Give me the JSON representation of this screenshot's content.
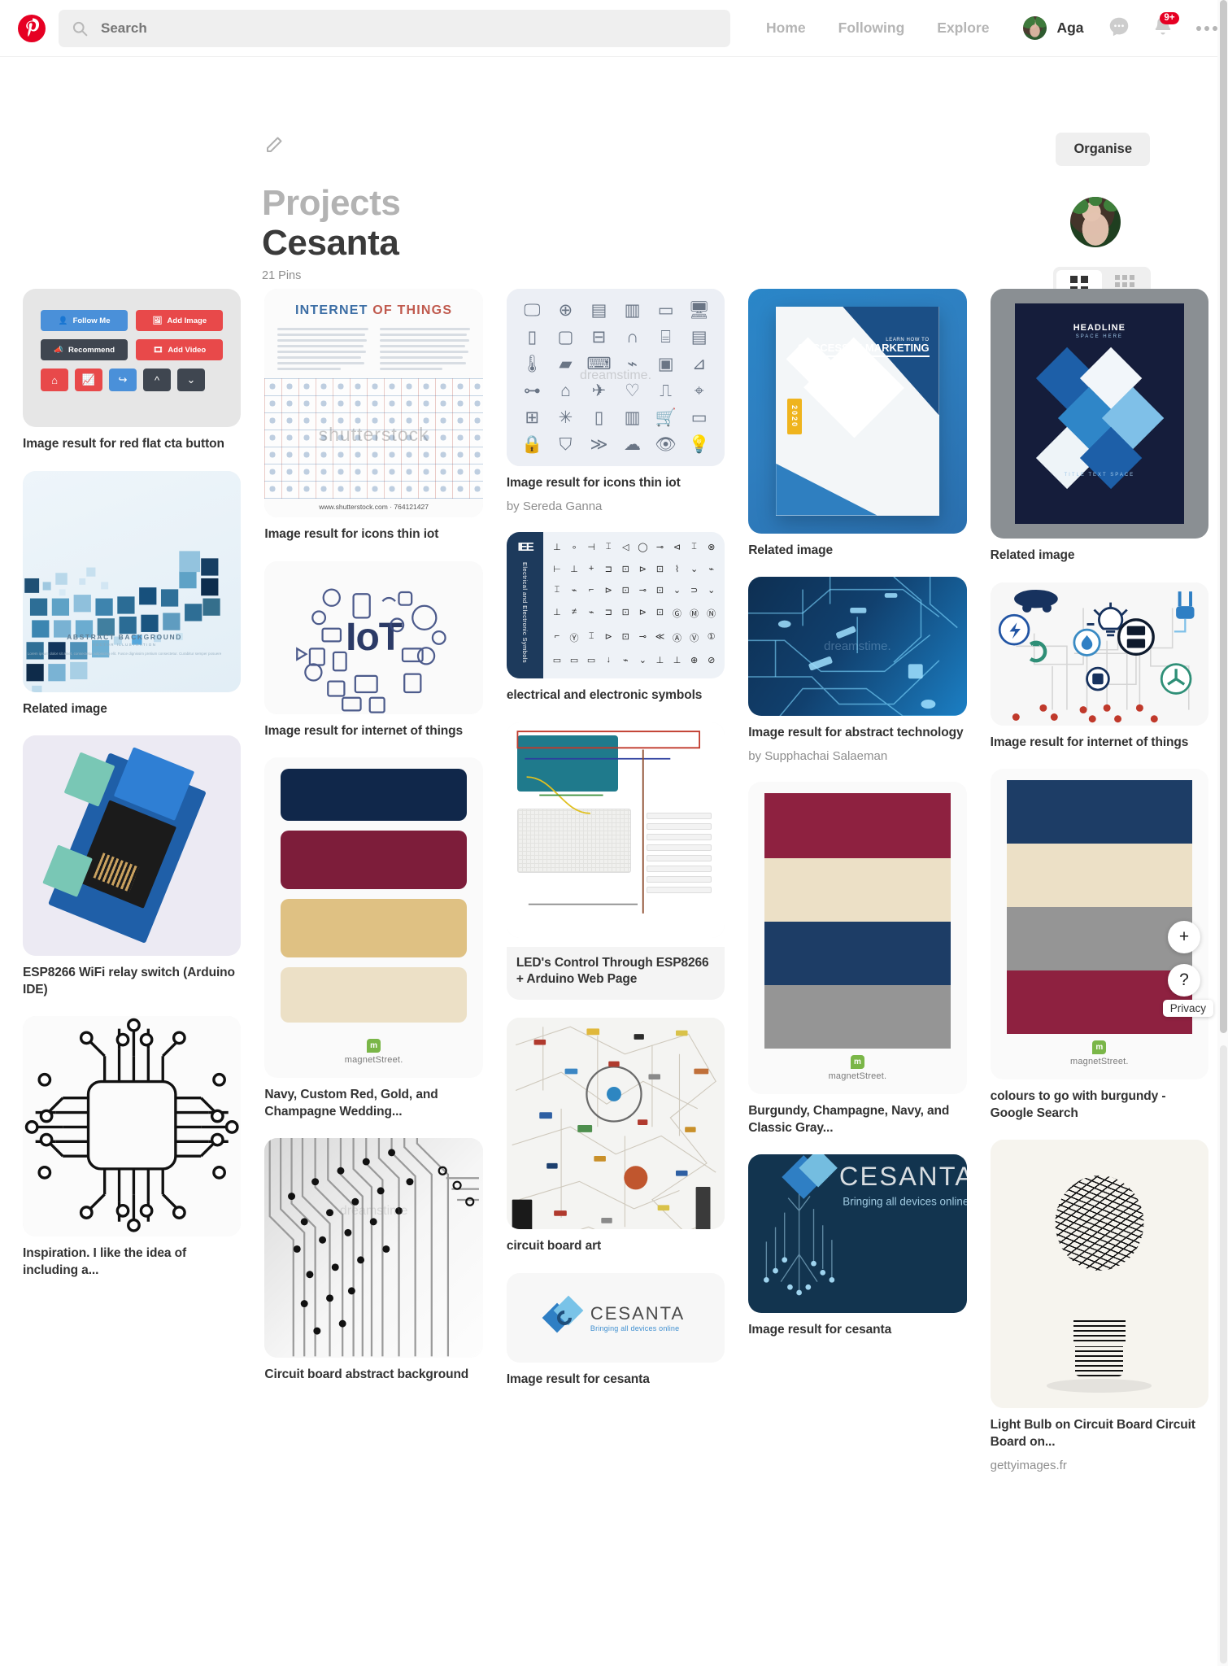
{
  "header": {
    "logo_icon": "pinterest-logo",
    "search": {
      "placeholder": "Search",
      "value": ""
    },
    "nav": [
      {
        "label": "Home"
      },
      {
        "label": "Following"
      },
      {
        "label": "Explore"
      }
    ],
    "user": {
      "name": "Aga"
    },
    "messages_icon": "chat-bubble-icon",
    "notifications_icon": "bell-icon",
    "notifications_badge": "9+",
    "more_icon": "ellipsis-icon"
  },
  "board": {
    "edit_icon": "pencil-icon",
    "organise_label": "Organise",
    "section_label": "Projects",
    "name": "Cesanta",
    "pin_count": "21 Pins",
    "view_grid_icon": "grid-large-icon",
    "view_dense_icon": "grid-dense-icon"
  },
  "overlay": {
    "add_label": "+",
    "help_label": "?",
    "privacy_label": "Privacy"
  },
  "columns": [
    {
      "pins": [
        {
          "title": "Image result for red flat cta button",
          "sub": "",
          "art": "cta-buttons",
          "cta": {
            "row1": [
              {
                "label": "Follow Me",
                "color": "#4a90d9",
                "icon": "user-plus-icon"
              },
              {
                "label": "Add Image",
                "color": "#e8494a",
                "icon": "image-icon"
              }
            ],
            "row2": [
              {
                "label": "Recommend",
                "color": "#3f4650",
                "icon": "megaphone-icon"
              },
              {
                "label": "Add Video",
                "color": "#e8494a",
                "icon": "video-icon"
              }
            ],
            "row3": [
              {
                "icon": "home-icon",
                "color": "#e8494a"
              },
              {
                "icon": "chart-icon",
                "color": "#e8494a"
              },
              {
                "icon": "share-icon",
                "color": "#4a90d9"
              },
              {
                "icon": "chevron-up-icon",
                "color": "#3f4650"
              },
              {
                "icon": "chevron-down-icon",
                "color": "#3f4650"
              }
            ]
          }
        },
        {
          "title": "Related image",
          "sub": "",
          "art": "abstract-squares",
          "caption_title": "ABSTRACT BACKGROUND",
          "caption_sub": "VECTOR ILLUSTRATION",
          "caption_body": "Lorem ipsum dolor sit amet, consectetur adipiscing elit. Fusce dignissim pretium consectetur. Curabitur semper posuere"
        },
        {
          "title": "ESP8266 WiFi relay switch (Arduino IDE)",
          "sub": "",
          "art": "esp-relay"
        },
        {
          "title": "Inspiration. I like the idea of including a...",
          "sub": "",
          "art": "circuit-outline"
        }
      ]
    },
    {
      "pins": [
        {
          "title": "Image result for icons thin iot",
          "sub": "",
          "art": "shutterstock-iot",
          "heading_a": "INTERNET",
          "heading_b": "OF THINGS",
          "watermark": "shutterstock",
          "footer": "www.shutterstock.com  ·  764121427"
        },
        {
          "title": "Image result for internet of things",
          "sub": "",
          "art": "iot-circle",
          "word": "IoT"
        },
        {
          "title": "Navy, Custom Red, Gold, and Champagne Wedding...",
          "sub": "",
          "art": "palette-rounded",
          "swatches": [
            "#10274a",
            "#7d1d3a",
            "#dfc183",
            "#ece0c6"
          ],
          "brand": "magnetStreet."
        },
        {
          "title": "Circuit board abstract background",
          "sub": "",
          "art": "circuit-abstract",
          "watermark": "dreamstime"
        }
      ]
    },
    {
      "pins": [
        {
          "title": "Image result for icons thin iot",
          "sub": "by Sereda Ganna",
          "art": "icon-grid",
          "watermark": "dreamstime.",
          "icons": [
            "🖥",
            "🌐",
            "🧺",
            "📟",
            "💻",
            "🖳",
            "📱",
            "📲",
            "🔲",
            "🎧",
            "⌚",
            "🗄",
            "🌡",
            "🔋",
            "🎮",
            "📡",
            "📷",
            "📹",
            "🚗",
            "🏠",
            "✈",
            "💓",
            "🔌",
            "🛩",
            "🏭",
            "🌀",
            "🚪",
            "♨",
            "🛒",
            "👓",
            "🔒",
            "🛡",
            "📶",
            "☁",
            "👁",
            "💡"
          ]
        },
        {
          "title": "electrical and electronic symbols",
          "sub": "",
          "art": "ieee-symbols",
          "brand": "IEE",
          "side_text": "Electrical and Electronic Symbols"
        },
        {
          "title": "LED's Control Through ESP8266 + Arduino Web Page",
          "sub": "",
          "art": "fritzing"
        },
        {
          "title": "circuit board art",
          "sub": "",
          "art": "resistor-network"
        },
        {
          "title": "Image result for cesanta",
          "sub": "",
          "art": "cesanta-light",
          "brand": "CESANTA",
          "tagline": "Bringing all devices online"
        }
      ]
    },
    {
      "pins": [
        {
          "title": "Related image",
          "sub": "",
          "art": "marketing-poster",
          "kicker": "LEARN HOW TO",
          "headline": "SUCCESS IN MARKETING",
          "year": "2020"
        },
        {
          "title": "Image result for abstract technology",
          "sub": "by Supphachai Salaeman",
          "art": "circuit-tech",
          "watermark": "dreamstime."
        },
        {
          "title": "Burgundy, Champagne, Navy, and Classic Gray...",
          "sub": "",
          "art": "palette-flat",
          "swatches": [
            "#8e2140",
            "#ece0c6",
            "#1d3d66",
            "#959595"
          ],
          "brand": "magnetStreet."
        },
        {
          "title": "Image result for cesanta",
          "sub": "",
          "art": "cesanta-dark",
          "brand": "CESANTA",
          "tagline": "Bringing all devices online"
        }
      ]
    },
    {
      "pins": [
        {
          "title": "Related image",
          "sub": "",
          "art": "headline-poster",
          "headline": "HEADLINE",
          "subhead": "SPACE HERE",
          "footer": "TITLE TEXT SPACE"
        },
        {
          "title": "Image result for internet of things",
          "sub": "",
          "art": "iot-infographic"
        },
        {
          "title": "colours to go with burgundy - Google Search",
          "sub": "",
          "art": "palette-flat2",
          "swatches": [
            "#1d3d66",
            "#ece0c6",
            "#959595",
            "#8e2140"
          ],
          "brand": "magnetStreet."
        },
        {
          "title": "Light Bulb on Circuit Board Circuit Board on...",
          "sub": "gettyimages.fr",
          "art": "lightbulb"
        }
      ]
    }
  ]
}
